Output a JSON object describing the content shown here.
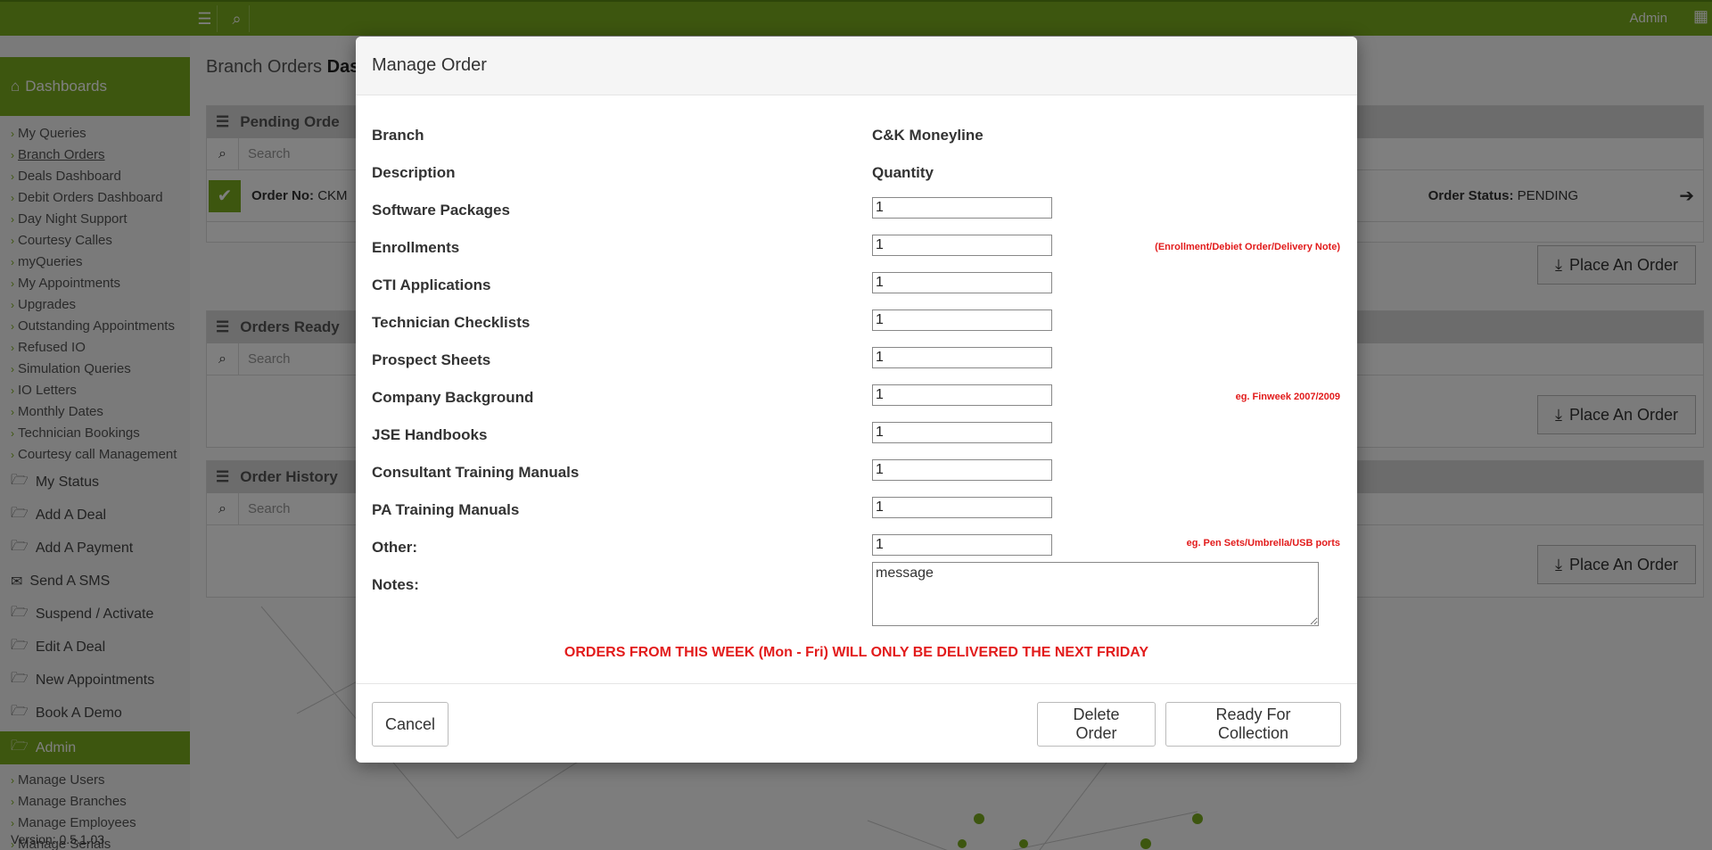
{
  "topbar": {
    "user_label": "Admin"
  },
  "sidebar": {
    "dashboards_label": "Dashboards",
    "sub_items": [
      "My Queries",
      "Branch Orders",
      "Deals Dashboard",
      "Debit Orders Dashboard",
      "Day Night Support",
      "Courtesy Calles",
      "myQueries",
      "My Appointments",
      "Upgrades",
      "Outstanding Appointments",
      "Refused IO",
      "Simulation Queries",
      "IO Letters",
      "Monthly Dates",
      "Technician Bookings",
      "Courtesy call Management"
    ],
    "sections": [
      "My Status",
      "Add A Deal",
      "Add A Payment",
      "Send A SMS",
      "Suspend / Activate",
      "Edit A Deal",
      "New Appointments",
      "Book A Demo"
    ],
    "admin_label": "Admin",
    "admin_items": [
      "Manage Users",
      "Manage Branches",
      "Manage Employees",
      "Manage Serials"
    ],
    "version": "Version: 0.5.1.03"
  },
  "page": {
    "title_prefix": "Branch Orders",
    "title_bold": "Das",
    "search_placeholder": "Search",
    "panels": {
      "pending": "Pending Orde",
      "ready": "Orders Ready",
      "history": "Order History"
    },
    "order_no_label": "Order No:",
    "order_no_value": "CKM",
    "order_status_label": "Order Status:",
    "order_status_value": "PENDING",
    "place_order_label": "Place An Order"
  },
  "modal": {
    "title": "Manage Order",
    "branch_label": "Branch",
    "branch_value": "C&K Moneyline",
    "description_label": "Description",
    "quantity_label": "Quantity",
    "items": [
      {
        "label": "Software Packages",
        "value": "1",
        "hint": ""
      },
      {
        "label": "Enrollments",
        "value": "1",
        "hint": "(Enrollment/Debiet Order/Delivery Note)"
      },
      {
        "label": "CTI Applications",
        "value": "1",
        "hint": ""
      },
      {
        "label": "Technician Checklists",
        "value": "1",
        "hint": ""
      },
      {
        "label": "Prospect Sheets",
        "value": "1",
        "hint": ""
      },
      {
        "label": "Company Background",
        "value": "1",
        "hint": "eg. Finweek 2007/2009"
      },
      {
        "label": "JSE Handbooks",
        "value": "1",
        "hint": ""
      },
      {
        "label": "Consultant Training Manuals",
        "value": "1",
        "hint": ""
      },
      {
        "label": "PA Training Manuals",
        "value": "1",
        "hint": ""
      },
      {
        "label": "Other:",
        "value": "1",
        "hint": "eg. Pen Sets/Umbrella/USB ports"
      }
    ],
    "notes_label": "Notes:",
    "notes_value": "message",
    "warning": "ORDERS FROM THIS WEEK (Mon - Fri) WILL ONLY BE DELIVERED THE NEXT FRIDAY",
    "cancel_label": "Cancel",
    "delete_label": "Delete Order",
    "ready_label": "Ready For Collection"
  }
}
